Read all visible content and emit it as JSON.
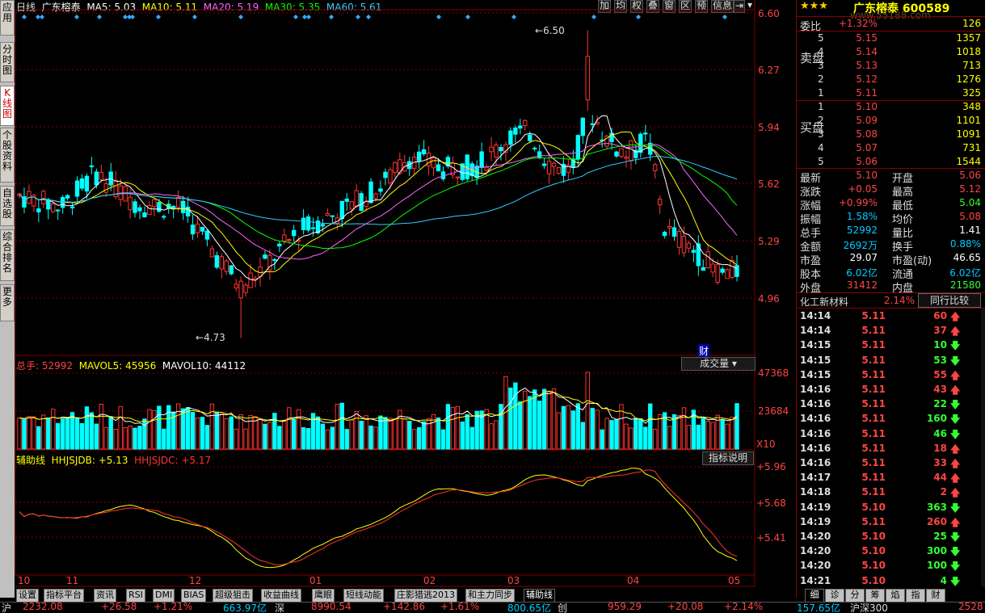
{
  "stock": {
    "name": "广东榕泰",
    "code": "600589",
    "watermark": "www.55188.com",
    "period": "日线"
  },
  "ma": {
    "ma5": "MA5: 5.03",
    "ma10": "MA10: 5.11",
    "ma20": "MA20: 5.19",
    "ma30": "MA30: 5.35",
    "ma60": "MA60: 5.61"
  },
  "toolbar": [
    "加",
    "均",
    "权",
    "叠",
    "窗",
    "区",
    "预",
    "信息"
  ],
  "price_axis": [
    "6.60",
    "6.27",
    "5.94",
    "5.62",
    "5.29",
    "4.96"
  ],
  "annotations": {
    "high": "6.50",
    "low": "4.73",
    "cai": "财"
  },
  "volume": {
    "label": "总手: 52992",
    "mavol5": "MAVOL5: 45956",
    "mavol10": "MAVOL10: 44112",
    "dropdown": "成交量",
    "axis_top": "47368",
    "axis_mid": "23684",
    "x10": "X10"
  },
  "indicator": {
    "label": "辅助线",
    "db": "HHJSJDB: +5.13",
    "dc": "HHJSJDC: +5.17",
    "explain_btn": "指标说明",
    "axis": [
      "+5.96",
      "+5.68",
      "+5.41"
    ]
  },
  "date_axis": [
    "10",
    "11",
    "12",
    "01",
    "02",
    "03",
    "04",
    "05"
  ],
  "left_tabs": [
    "应用",
    "分时图",
    "K线图",
    "个股资料",
    "自选股",
    "综合排名",
    "更多"
  ],
  "bottom_tabs": [
    "设置",
    "指标平台",
    "资讯",
    "RSI",
    "DMI",
    "BIAS",
    "超级狙击",
    "收益曲线",
    "鹰眼",
    "短线动能",
    "庄影猎逃2013",
    "和主力同步",
    "辅助线"
  ],
  "quote": {
    "weibi_label": "委比",
    "weibi_val": "+1.32%",
    "weibi_n": "126",
    "sell_label": "卖盘",
    "buy_label": "买盘",
    "sell": [
      {
        "lv": "5",
        "p": "5.15",
        "v": "1357"
      },
      {
        "lv": "4",
        "p": "5.14",
        "v": "1018"
      },
      {
        "lv": "3",
        "p": "5.13",
        "v": "713"
      },
      {
        "lv": "2",
        "p": "5.12",
        "v": "1276"
      },
      {
        "lv": "1",
        "p": "5.11",
        "v": "325"
      }
    ],
    "buy": [
      {
        "lv": "1",
        "p": "5.10",
        "v": "348"
      },
      {
        "lv": "2",
        "p": "5.09",
        "v": "1101"
      },
      {
        "lv": "3",
        "p": "5.08",
        "v": "1091"
      },
      {
        "lv": "4",
        "p": "5.07",
        "v": "731"
      },
      {
        "lv": "5",
        "p": "5.06",
        "v": "1544"
      }
    ],
    "stats": [
      {
        "k1": "最新",
        "v1": "5.10",
        "c1": "#ff4444",
        "k2": "开盘",
        "v2": "5.06",
        "c2": "#ff4444"
      },
      {
        "k1": "涨跌",
        "v1": "+0.05",
        "c1": "#ff4444",
        "k2": "最高",
        "v2": "5.12",
        "c2": "#ff4444"
      },
      {
        "k1": "涨幅",
        "v1": "+0.99%",
        "c1": "#ff4444",
        "k2": "最低",
        "v2": "5.04",
        "c2": "#33ff33"
      },
      {
        "k1": "振幅",
        "v1": "1.58%",
        "c1": "#00ccff",
        "k2": "均价",
        "v2": "5.08",
        "c2": "#ff4444"
      },
      {
        "k1": "总手",
        "v1": "52992",
        "c1": "#00ccff",
        "k2": "量比",
        "v2": "1.41",
        "c2": "#ffffff"
      },
      {
        "k1": "金额",
        "v1": "2692万",
        "c1": "#00ccff",
        "k2": "换手",
        "v2": "0.88%",
        "c2": "#00ccff"
      },
      {
        "k1": "市盈",
        "v1": "29.07",
        "c1": "#ffffff",
        "k2": "市盈(动)",
        "v2": "46.65",
        "c2": "#ffffff"
      },
      {
        "k1": "股本",
        "v1": "6.02亿",
        "c1": "#00ccff",
        "k2": "流通",
        "v2": "6.02亿",
        "c2": "#00ccff"
      },
      {
        "k1": "外盘",
        "v1": "31412",
        "c1": "#ff4444",
        "k2": "内盘",
        "v2": "21580",
        "c2": "#33ff33"
      }
    ],
    "sector": "化工新材料",
    "sector_chg": "2.14%",
    "sector_btn": "同行比较"
  },
  "ticks": [
    {
      "t": "14:14",
      "p": "5.11",
      "v": "60",
      "d": "up"
    },
    {
      "t": "14:14",
      "p": "5.11",
      "v": "37",
      "d": "up"
    },
    {
      "t": "14:15",
      "p": "5.11",
      "v": "10",
      "d": "down"
    },
    {
      "t": "14:15",
      "p": "5.11",
      "v": "53",
      "d": "down"
    },
    {
      "t": "14:15",
      "p": "5.11",
      "v": "55",
      "d": "up"
    },
    {
      "t": "14:16",
      "p": "5.11",
      "v": "43",
      "d": "up"
    },
    {
      "t": "14:16",
      "p": "5.11",
      "v": "22",
      "d": "down"
    },
    {
      "t": "14:16",
      "p": "5.11",
      "v": "160",
      "d": "down"
    },
    {
      "t": "14:16",
      "p": "5.11",
      "v": "46",
      "d": "down"
    },
    {
      "t": "14:16",
      "p": "5.11",
      "v": "18",
      "d": "up"
    },
    {
      "t": "14:16",
      "p": "5.11",
      "v": "33",
      "d": "up"
    },
    {
      "t": "14:17",
      "p": "5.11",
      "v": "44",
      "d": "up"
    },
    {
      "t": "14:18",
      "p": "5.11",
      "v": "2",
      "d": "up"
    },
    {
      "t": "14:19",
      "p": "5.10",
      "v": "363",
      "d": "down"
    },
    {
      "t": "14:19",
      "p": "5.11",
      "v": "260",
      "d": "up"
    },
    {
      "t": "14:20",
      "p": "5.10",
      "v": "25",
      "d": "down"
    },
    {
      "t": "14:20",
      "p": "5.10",
      "v": "300",
      "d": "down"
    },
    {
      "t": "14:20",
      "p": "5.10",
      "v": "100",
      "d": "down"
    },
    {
      "t": "14:21",
      "p": "5.10",
      "v": "4",
      "d": "down"
    }
  ],
  "right_tabs": [
    "细",
    "诊",
    "分",
    "筹",
    "焰",
    "指",
    "财"
  ],
  "status": {
    "a": "沪",
    "b": "2232.08",
    "c": "+26.58",
    "d": "+1.21%",
    "e": "663.97亿",
    "f": "深",
    "g": "8990.54",
    "h": "+142.86",
    "i": "+1.61%",
    "j": "800.65亿",
    "k": "创",
    "l": "959.29",
    "m": "+20.08",
    "n": "+2.14%",
    "o": "157.65亿",
    "p": "沪深300",
    "q": "2528"
  },
  "colors": {
    "up": "#ff3333",
    "down": "#00ffff",
    "ma5": "#ffffff",
    "ma10": "#ffff00",
    "ma20": "#ff66ff",
    "ma30": "#00ff00",
    "ma60": "#33ccff"
  }
}
